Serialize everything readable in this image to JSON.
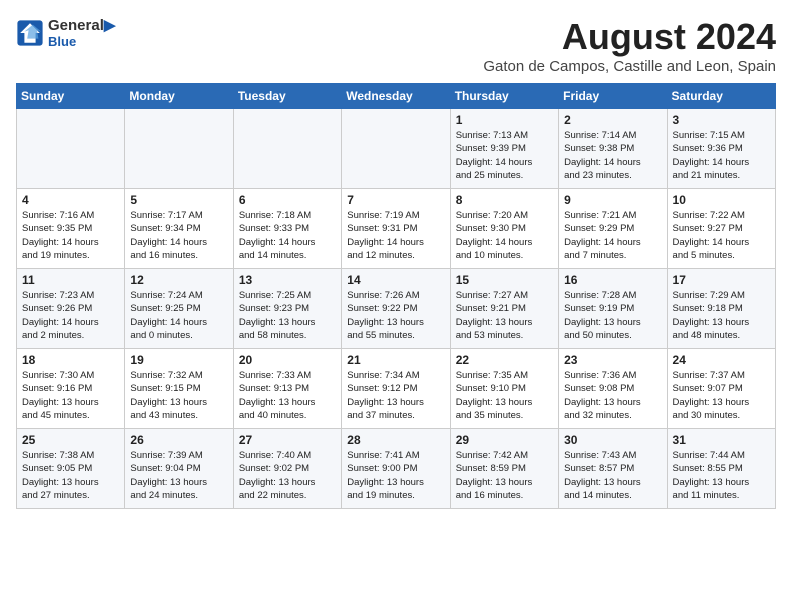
{
  "header": {
    "logo_line1": "General",
    "logo_line2": "Blue",
    "month_year": "August 2024",
    "location": "Gaton de Campos, Castille and Leon, Spain"
  },
  "weekdays": [
    "Sunday",
    "Monday",
    "Tuesday",
    "Wednesday",
    "Thursday",
    "Friday",
    "Saturday"
  ],
  "weeks": [
    [
      {
        "day": "",
        "info": ""
      },
      {
        "day": "",
        "info": ""
      },
      {
        "day": "",
        "info": ""
      },
      {
        "day": "",
        "info": ""
      },
      {
        "day": "1",
        "info": "Sunrise: 7:13 AM\nSunset: 9:39 PM\nDaylight: 14 hours\nand 25 minutes."
      },
      {
        "day": "2",
        "info": "Sunrise: 7:14 AM\nSunset: 9:38 PM\nDaylight: 14 hours\nand 23 minutes."
      },
      {
        "day": "3",
        "info": "Sunrise: 7:15 AM\nSunset: 9:36 PM\nDaylight: 14 hours\nand 21 minutes."
      }
    ],
    [
      {
        "day": "4",
        "info": "Sunrise: 7:16 AM\nSunset: 9:35 PM\nDaylight: 14 hours\nand 19 minutes."
      },
      {
        "day": "5",
        "info": "Sunrise: 7:17 AM\nSunset: 9:34 PM\nDaylight: 14 hours\nand 16 minutes."
      },
      {
        "day": "6",
        "info": "Sunrise: 7:18 AM\nSunset: 9:33 PM\nDaylight: 14 hours\nand 14 minutes."
      },
      {
        "day": "7",
        "info": "Sunrise: 7:19 AM\nSunset: 9:31 PM\nDaylight: 14 hours\nand 12 minutes."
      },
      {
        "day": "8",
        "info": "Sunrise: 7:20 AM\nSunset: 9:30 PM\nDaylight: 14 hours\nand 10 minutes."
      },
      {
        "day": "9",
        "info": "Sunrise: 7:21 AM\nSunset: 9:29 PM\nDaylight: 14 hours\nand 7 minutes."
      },
      {
        "day": "10",
        "info": "Sunrise: 7:22 AM\nSunset: 9:27 PM\nDaylight: 14 hours\nand 5 minutes."
      }
    ],
    [
      {
        "day": "11",
        "info": "Sunrise: 7:23 AM\nSunset: 9:26 PM\nDaylight: 14 hours\nand 2 minutes."
      },
      {
        "day": "12",
        "info": "Sunrise: 7:24 AM\nSunset: 9:25 PM\nDaylight: 14 hours\nand 0 minutes."
      },
      {
        "day": "13",
        "info": "Sunrise: 7:25 AM\nSunset: 9:23 PM\nDaylight: 13 hours\nand 58 minutes."
      },
      {
        "day": "14",
        "info": "Sunrise: 7:26 AM\nSunset: 9:22 PM\nDaylight: 13 hours\nand 55 minutes."
      },
      {
        "day": "15",
        "info": "Sunrise: 7:27 AM\nSunset: 9:21 PM\nDaylight: 13 hours\nand 53 minutes."
      },
      {
        "day": "16",
        "info": "Sunrise: 7:28 AM\nSunset: 9:19 PM\nDaylight: 13 hours\nand 50 minutes."
      },
      {
        "day": "17",
        "info": "Sunrise: 7:29 AM\nSunset: 9:18 PM\nDaylight: 13 hours\nand 48 minutes."
      }
    ],
    [
      {
        "day": "18",
        "info": "Sunrise: 7:30 AM\nSunset: 9:16 PM\nDaylight: 13 hours\nand 45 minutes."
      },
      {
        "day": "19",
        "info": "Sunrise: 7:32 AM\nSunset: 9:15 PM\nDaylight: 13 hours\nand 43 minutes."
      },
      {
        "day": "20",
        "info": "Sunrise: 7:33 AM\nSunset: 9:13 PM\nDaylight: 13 hours\nand 40 minutes."
      },
      {
        "day": "21",
        "info": "Sunrise: 7:34 AM\nSunset: 9:12 PM\nDaylight: 13 hours\nand 37 minutes."
      },
      {
        "day": "22",
        "info": "Sunrise: 7:35 AM\nSunset: 9:10 PM\nDaylight: 13 hours\nand 35 minutes."
      },
      {
        "day": "23",
        "info": "Sunrise: 7:36 AM\nSunset: 9:08 PM\nDaylight: 13 hours\nand 32 minutes."
      },
      {
        "day": "24",
        "info": "Sunrise: 7:37 AM\nSunset: 9:07 PM\nDaylight: 13 hours\nand 30 minutes."
      }
    ],
    [
      {
        "day": "25",
        "info": "Sunrise: 7:38 AM\nSunset: 9:05 PM\nDaylight: 13 hours\nand 27 minutes."
      },
      {
        "day": "26",
        "info": "Sunrise: 7:39 AM\nSunset: 9:04 PM\nDaylight: 13 hours\nand 24 minutes."
      },
      {
        "day": "27",
        "info": "Sunrise: 7:40 AM\nSunset: 9:02 PM\nDaylight: 13 hours\nand 22 minutes."
      },
      {
        "day": "28",
        "info": "Sunrise: 7:41 AM\nSunset: 9:00 PM\nDaylight: 13 hours\nand 19 minutes."
      },
      {
        "day": "29",
        "info": "Sunrise: 7:42 AM\nSunset: 8:59 PM\nDaylight: 13 hours\nand 16 minutes."
      },
      {
        "day": "30",
        "info": "Sunrise: 7:43 AM\nSunset: 8:57 PM\nDaylight: 13 hours\nand 14 minutes."
      },
      {
        "day": "31",
        "info": "Sunrise: 7:44 AM\nSunset: 8:55 PM\nDaylight: 13 hours\nand 11 minutes."
      }
    ]
  ]
}
